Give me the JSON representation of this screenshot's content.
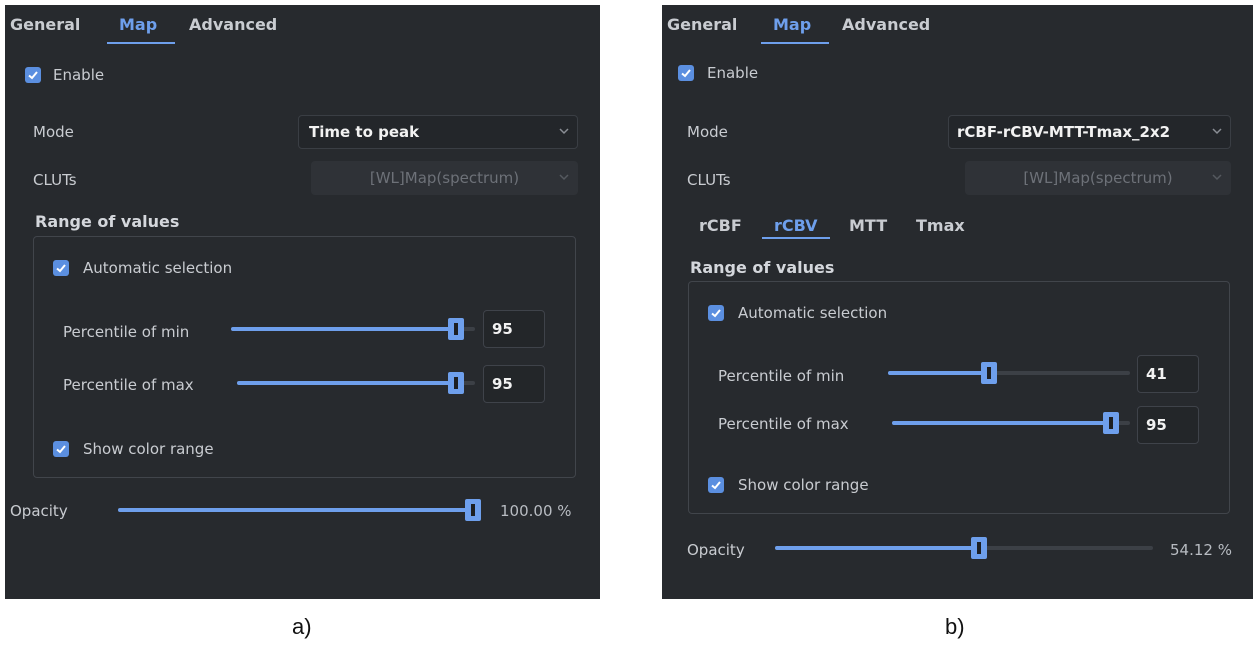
{
  "tabs": [
    "General",
    "Map",
    "Advanced"
  ],
  "enable_label": "Enable",
  "mode_label": "Mode",
  "cluts_label": "CLUTs",
  "cluts_value": "[WL]Map(spectrum)",
  "range_title": "Range of values",
  "auto_selection": "Automatic selection",
  "pmin_label": "Percentile of min",
  "pmax_label": "Percentile of max",
  "show_color_range": "Show color range",
  "opacity_label": "Opacity",
  "colors": {
    "panel_bg": "#272a2e",
    "accent": "#6e9fec",
    "text": "#c9ccd1"
  },
  "panel_a": {
    "caption": "a)",
    "mode_value": "Time to peak",
    "pmin": {
      "value": "95",
      "fraction": 0.95
    },
    "pmax": {
      "value": "95",
      "fraction": 0.95
    },
    "opacity": {
      "value": "100.00 %",
      "fraction": 1.0
    }
  },
  "panel_b": {
    "caption": "b)",
    "mode_value": "rCBF-rCBV-MTT-Tmax_2x2",
    "map_tabs": [
      "rCBF",
      "rCBV",
      "MTT",
      "Tmax"
    ],
    "active_map_tab": "rCBV",
    "pmin": {
      "value": "41",
      "fraction": 0.41
    },
    "pmax": {
      "value": "95",
      "fraction": 0.95
    },
    "opacity": {
      "value": "54.12 %",
      "fraction": 0.5412
    }
  }
}
